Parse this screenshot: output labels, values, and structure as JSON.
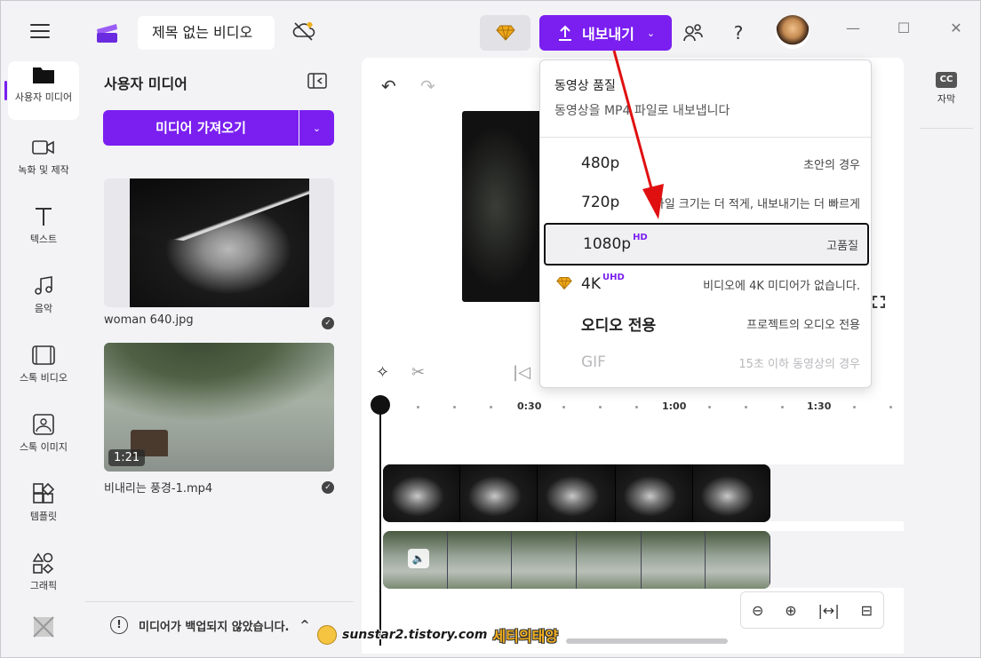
{
  "header": {
    "project_title": "제목 없는 비디오",
    "export_label": "내보내기",
    "help_label": "?"
  },
  "nav": {
    "items": [
      {
        "label": "사용자 미디어",
        "icon": "folder-icon"
      },
      {
        "label": "녹화 및 제작",
        "icon": "video-camera-icon"
      },
      {
        "label": "텍스트",
        "icon": "text-icon"
      },
      {
        "label": "음악",
        "icon": "music-note-icon"
      },
      {
        "label": "스톡 비디오",
        "icon": "film-icon"
      },
      {
        "label": "스톡 이미지",
        "icon": "image-icon"
      },
      {
        "label": "템플릿",
        "icon": "template-icon"
      },
      {
        "label": "그래픽",
        "icon": "shapes-icon"
      }
    ]
  },
  "media": {
    "title": "사용자 미디어",
    "import_label": "미디어 가져오기",
    "items": [
      {
        "name": "woman 640.jpg"
      },
      {
        "name": "비내리는 풍경-1.mp4",
        "duration": "1:21"
      }
    ],
    "backup_notice": "미디어가 백업되지 않았습니다."
  },
  "timeline": {
    "ticks": [
      "0:30",
      "1:00",
      "1:30"
    ]
  },
  "right_rail": {
    "cc_badge": "CC",
    "captions_label": "자막"
  },
  "export_menu": {
    "title": "동영상 품질",
    "subtitle": "동영상을 MP4 파일로 내보냅니다",
    "options": [
      {
        "label": "480p",
        "badge": "",
        "desc": "초안의 경우"
      },
      {
        "label": "720p",
        "badge": "",
        "desc": "파일 크기는 더 적게, 내보내기는 더 빠르게"
      },
      {
        "label": "1080p",
        "badge": "HD",
        "desc": "고품질",
        "selected": true
      },
      {
        "label": "4K",
        "badge": "UHD",
        "desc": "비디오에 4K 미디어가 없습니다.",
        "premium": true
      },
      {
        "label": "오디오 전용",
        "badge": "",
        "desc": "프로젝트의 오디오 전용"
      },
      {
        "label": "GIF",
        "badge": "",
        "desc": "15초 이하 동영상의 경우",
        "disabled": true
      }
    ]
  },
  "watermark": {
    "url": "sunstar2.tistory.com",
    "name": "세티의태양"
  },
  "colors": {
    "accent": "#7a1ff0",
    "annotation_arrow": "#e01010"
  }
}
